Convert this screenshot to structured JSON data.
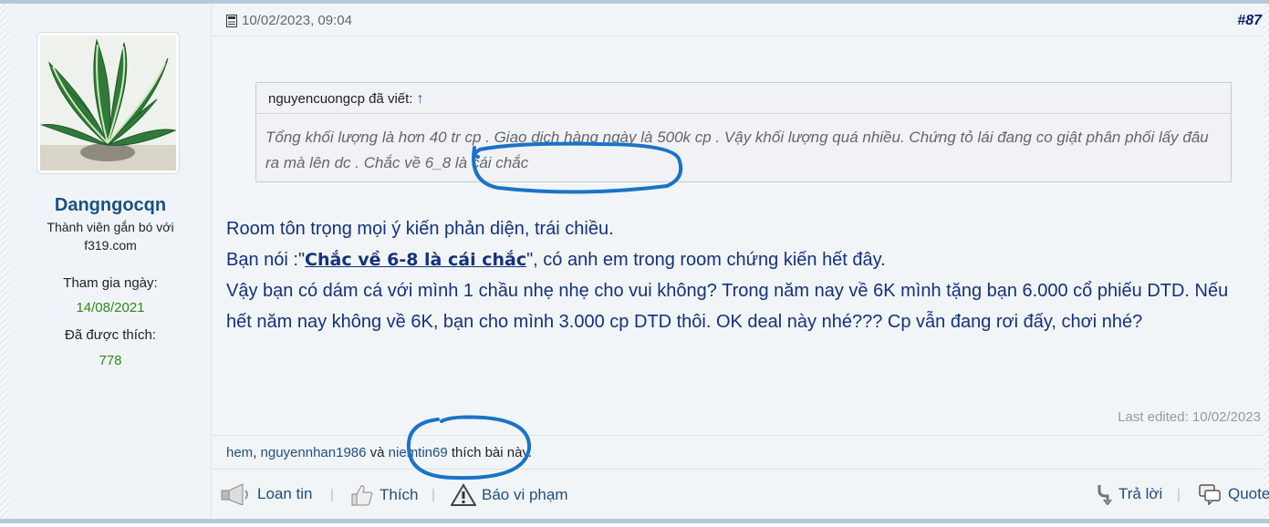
{
  "user": {
    "name": "Dangngocqn",
    "title": "Thành viên gắn bó với f319.com",
    "joined_label": "Tham gia ngày:",
    "joined_value": "14/08/2021",
    "liked_label": "Đã được thích:",
    "liked_value": "778"
  },
  "post": {
    "date": "10/02/2023, 09:04",
    "number": "#87",
    "quote_author": "nguyencuongcp đã viết:",
    "quote_arrow": "↑",
    "quote_text": "Tổng khối lượng là hơn 40 tr cp . Giao dịch hàng ngày là 500k cp . Vậy khối lượng quá nhiều. Chứng tỏ lái đang co giật phân phối lấy đâu ra mà lên dc . Chắc về 6_8 là cái chắc",
    "msg_line1": "Room tôn trọng mọi ý kiến phản diện, trái chiều.",
    "msg_line2_pre": "Bạn nói :\"",
    "msg_line2_link": "Chắc về 6-8 là cái chắc",
    "msg_line2_post": "\", có anh em trong room chứng kiến hết đây.",
    "msg_line3": "Vậy bạn có dám cá với mình 1 chầu nhẹ nhẹ cho vui không? Trong năm nay về 6K mình tặng bạn 6.000 cổ phiếu DTD. Nếu hết năm nay không về 6K, bạn cho mình 3.000 cp DTD thôi. OK deal này nhé??? Cp vẫn đang rơi đấy, chơi nhé?",
    "last_edited": "Last edited: 10/02/2023"
  },
  "likes": {
    "user1": "hem",
    "comma": ", ",
    "user2": "nguyennhan1986",
    "and": " và ",
    "user3": "niemtin69",
    "suffix": " thích bài này."
  },
  "actions": {
    "report": "Loan tin",
    "like": "Thích",
    "flag": "Báo vi phạm",
    "reply": "Trả lời",
    "quote": "Quote"
  },
  "colors": {
    "link": "#1f4e80",
    "message": "#14327a",
    "highlight_circle": "#1a73c7",
    "stat_value": "#2d8a16"
  }
}
